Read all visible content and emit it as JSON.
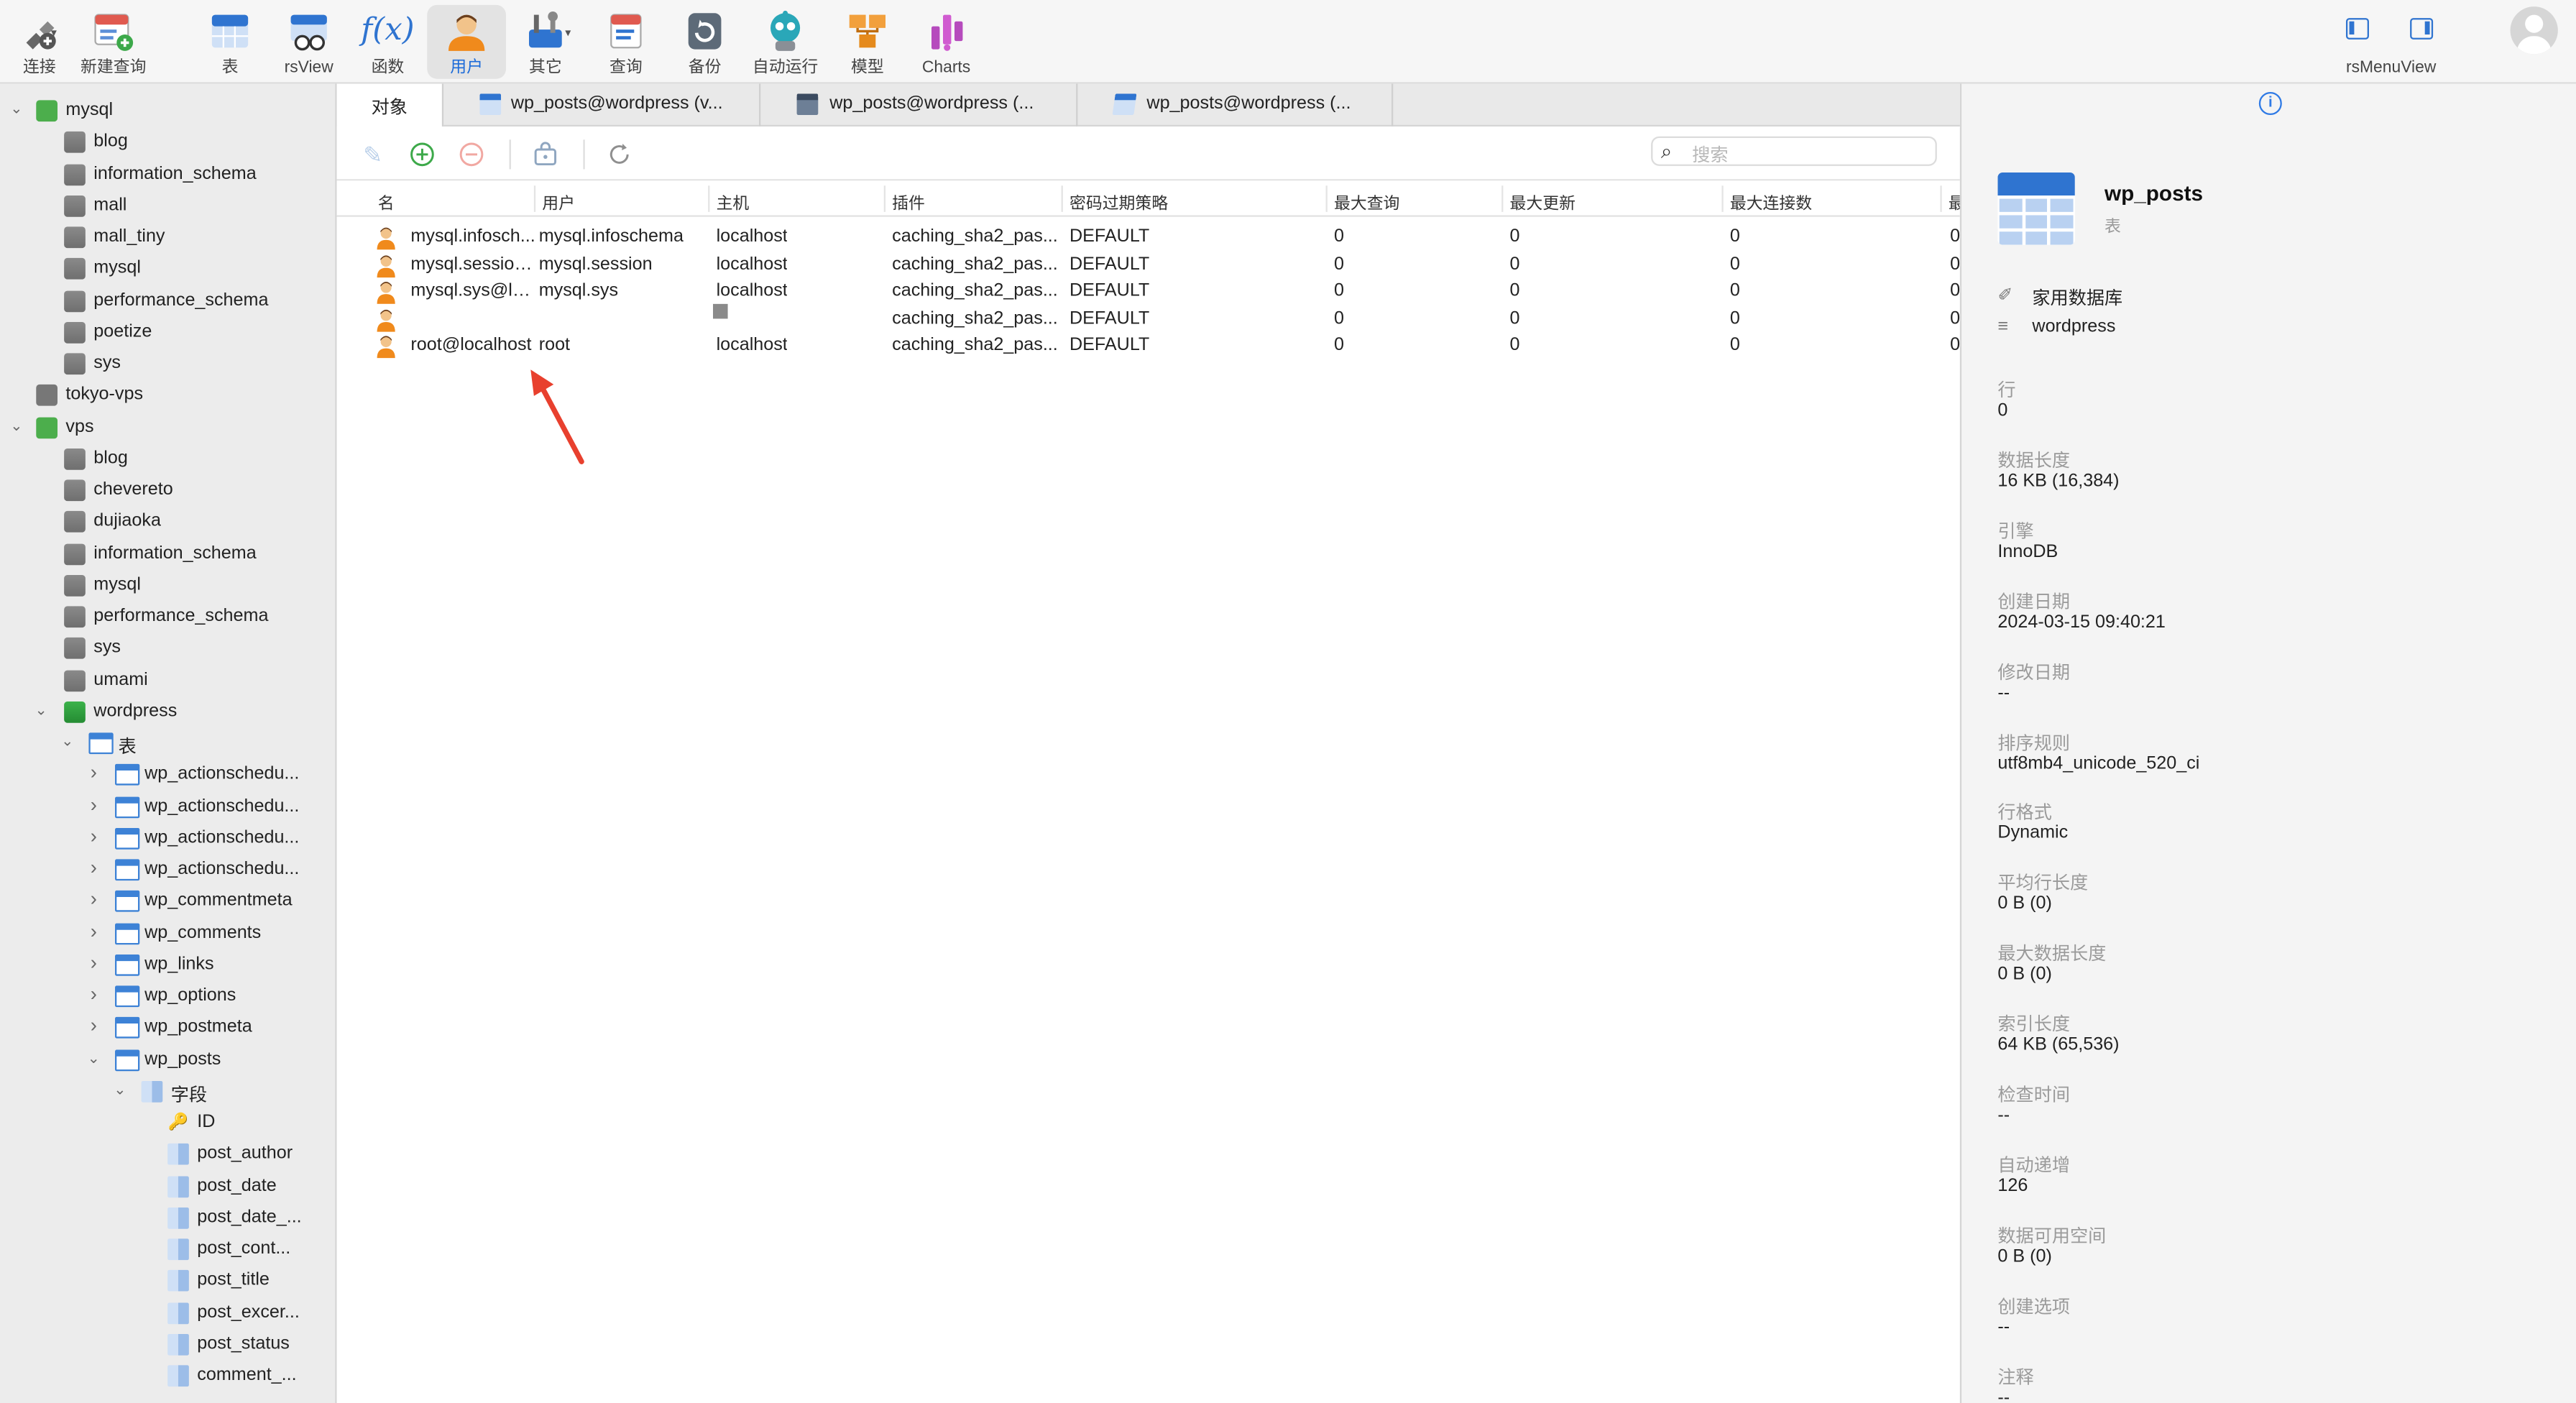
{
  "toolbar": {
    "buttons": [
      {
        "label": "连接",
        "icon": "connect-icon"
      },
      {
        "label": "新建查询",
        "icon": "new-query-icon"
      },
      {
        "label": "表",
        "icon": "table-icon"
      },
      {
        "label": "rsView",
        "icon": "view-icon"
      },
      {
        "label": "函数",
        "icon": "function-icon"
      },
      {
        "label": "用户",
        "icon": "user-icon",
        "active": true
      },
      {
        "label": "其它",
        "icon": "tools-icon"
      },
      {
        "label": "查询",
        "icon": "query-icon"
      },
      {
        "label": "备份",
        "icon": "backup-icon"
      },
      {
        "label": "自动运行",
        "icon": "robot-icon"
      },
      {
        "label": "模型",
        "icon": "model-icon"
      },
      {
        "label": "Charts",
        "icon": "charts-icon"
      }
    ],
    "right_label": "rsMenuView",
    "function_glyph": "f(x)"
  },
  "sidebar": {
    "items": [
      {
        "label": "mysql",
        "type": "conn",
        "level": 0,
        "chev": "down"
      },
      {
        "label": "blog",
        "type": "db",
        "level": 1
      },
      {
        "label": "information_schema",
        "type": "db",
        "level": 1
      },
      {
        "label": "mall",
        "type": "db",
        "level": 1
      },
      {
        "label": "mall_tiny",
        "type": "db",
        "level": 1
      },
      {
        "label": "mysql",
        "type": "db",
        "level": 1
      },
      {
        "label": "performance_schema",
        "type": "db",
        "level": 1
      },
      {
        "label": "poetize",
        "type": "db",
        "level": 1
      },
      {
        "label": "sys",
        "type": "db",
        "level": 1
      },
      {
        "label": "tokyo-vps",
        "type": "conn-gray",
        "level": 0
      },
      {
        "label": "vps",
        "type": "conn",
        "level": 0,
        "chev": "down"
      },
      {
        "label": "blog",
        "type": "db",
        "level": 1
      },
      {
        "label": "chevereto",
        "type": "db",
        "level": 1
      },
      {
        "label": "dujiaoka",
        "type": "db",
        "level": 1
      },
      {
        "label": "information_schema",
        "type": "db",
        "level": 1
      },
      {
        "label": "mysql",
        "type": "db",
        "level": 1
      },
      {
        "label": "performance_schema",
        "type": "db",
        "level": 1
      },
      {
        "label": "sys",
        "type": "db",
        "level": 1
      },
      {
        "label": "umami",
        "type": "db",
        "level": 1
      },
      {
        "label": "wordpress",
        "type": "db-green",
        "level": 1,
        "chev": "down"
      },
      {
        "label": "表",
        "type": "tbl",
        "level": 2,
        "chev": "down"
      },
      {
        "label": "wp_actionschedu...",
        "type": "tbl",
        "level": 3,
        "chev": "right"
      },
      {
        "label": "wp_actionschedu...",
        "type": "tbl",
        "level": 3,
        "chev": "right"
      },
      {
        "label": "wp_actionschedu...",
        "type": "tbl",
        "level": 3,
        "chev": "right"
      },
      {
        "label": "wp_actionschedu...",
        "type": "tbl",
        "level": 3,
        "chev": "right"
      },
      {
        "label": "wp_commentmeta",
        "type": "tbl",
        "level": 3,
        "chev": "right"
      },
      {
        "label": "wp_comments",
        "type": "tbl",
        "level": 3,
        "chev": "right"
      },
      {
        "label": "wp_links",
        "type": "tbl",
        "level": 3,
        "chev": "right"
      },
      {
        "label": "wp_options",
        "type": "tbl",
        "level": 3,
        "chev": "right"
      },
      {
        "label": "wp_postmeta",
        "type": "tbl",
        "level": 3,
        "chev": "right"
      },
      {
        "label": "wp_posts",
        "type": "tbl",
        "level": 3,
        "chev": "down"
      },
      {
        "label": "字段",
        "type": "fld",
        "level": 4,
        "chev": "down"
      },
      {
        "label": "ID",
        "type": "key",
        "level": 5
      },
      {
        "label": "post_author",
        "type": "fld",
        "level": 5
      },
      {
        "label": "post_date",
        "type": "fld",
        "level": 5
      },
      {
        "label": "post_date_...",
        "type": "fld",
        "level": 5
      },
      {
        "label": "post_cont...",
        "type": "fld",
        "level": 5
      },
      {
        "label": "post_title",
        "type": "fld",
        "level": 5
      },
      {
        "label": "post_excer...",
        "type": "fld",
        "level": 5
      },
      {
        "label": "post_status",
        "type": "fld",
        "level": 5
      },
      {
        "label": "comment_...",
        "type": "fld",
        "level": 5
      }
    ]
  },
  "tabs": [
    {
      "label": "对象",
      "active": true,
      "icon": ""
    },
    {
      "label": "wp_posts@wordpress (v...",
      "icon": "table-tab-icon"
    },
    {
      "label": "wp_posts@wordpress (...",
      "icon": "table-dark-tab-icon"
    },
    {
      "label": "wp_posts@wordpress (...",
      "icon": "edit-table-tab-icon"
    }
  ],
  "search": {
    "placeholder": "搜索"
  },
  "grid": {
    "headers": [
      "名",
      "用户",
      "主机",
      "插件",
      "密码过期策略",
      "最大查询",
      "最大更新",
      "最大连接数",
      "最"
    ],
    "rows": [
      [
        "mysql.infosch...",
        "mysql.infoschema",
        "localhost",
        "caching_sha2_pas...",
        "DEFAULT",
        "0",
        "0",
        "0",
        "0"
      ],
      [
        "mysql.session...",
        "mysql.session",
        "localhost",
        "caching_sha2_pas...",
        "DEFAULT",
        "0",
        "0",
        "0",
        "0"
      ],
      [
        "mysql.sys@lo...",
        "mysql.sys",
        "localhost",
        "caching_sha2_pas...",
        "DEFAULT",
        "0",
        "0",
        "0",
        "0"
      ],
      [
        "",
        "",
        "",
        "caching_sha2_pas...",
        "DEFAULT",
        "0",
        "0",
        "0",
        "0"
      ],
      [
        "root@localhost",
        "root",
        "localhost",
        "caching_sha2_pas...",
        "DEFAULT",
        "0",
        "0",
        "0",
        "0"
      ]
    ]
  },
  "info": {
    "title": "wp_posts",
    "subtitle": "表",
    "connection": "家用数据库",
    "database": "wordpress",
    "props": [
      {
        "k": "行",
        "v": "0"
      },
      {
        "k": "数据长度",
        "v": "16 KB (16,384)"
      },
      {
        "k": "引擎",
        "v": "InnoDB"
      },
      {
        "k": "创建日期",
        "v": "2024-03-15 09:40:21"
      },
      {
        "k": "修改日期",
        "v": "--"
      },
      {
        "k": "排序规则",
        "v": "utf8mb4_unicode_520_ci"
      },
      {
        "k": "行格式",
        "v": "Dynamic"
      },
      {
        "k": "平均行长度",
        "v": "0 B (0)"
      },
      {
        "k": "最大数据长度",
        "v": "0 B (0)"
      },
      {
        "k": "索引长度",
        "v": "64 KB (65,536)"
      },
      {
        "k": "检查时间",
        "v": "--"
      },
      {
        "k": "自动递增",
        "v": "126"
      },
      {
        "k": "数据可用空间",
        "v": "0 B (0)"
      },
      {
        "k": "创建选项",
        "v": "--"
      },
      {
        "k": "注释",
        "v": "--"
      }
    ]
  },
  "colors": {
    "accent": "#1c6bd9",
    "arrow": "#e8402e",
    "connection_green": "#4cae4c"
  }
}
